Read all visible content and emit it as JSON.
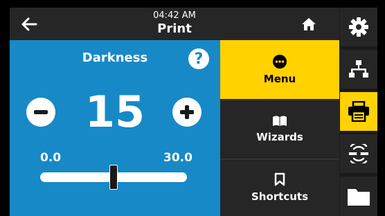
{
  "header": {
    "time": "04:42 AM",
    "title": "Print"
  },
  "darkness": {
    "title": "Darkness",
    "help": "?",
    "value": "15",
    "range_min": "0.0",
    "range_max": "30.0",
    "slider_fraction": 0.5
  },
  "menu": {
    "tiles": [
      {
        "label": "Menu",
        "active": true
      },
      {
        "label": "Wizards",
        "active": false
      },
      {
        "label": "Shortcuts",
        "active": false
      }
    ]
  },
  "sidebar": {
    "items": [
      {
        "icon": "gear-icon"
      },
      {
        "icon": "network-icon"
      },
      {
        "icon": "printer-icon",
        "active": true
      },
      {
        "icon": "wireless-icon"
      },
      {
        "icon": "folder-icon"
      }
    ]
  },
  "colors": {
    "accent": "#ffd200",
    "panel_blue": "#1789c6",
    "dark": "#262626"
  }
}
